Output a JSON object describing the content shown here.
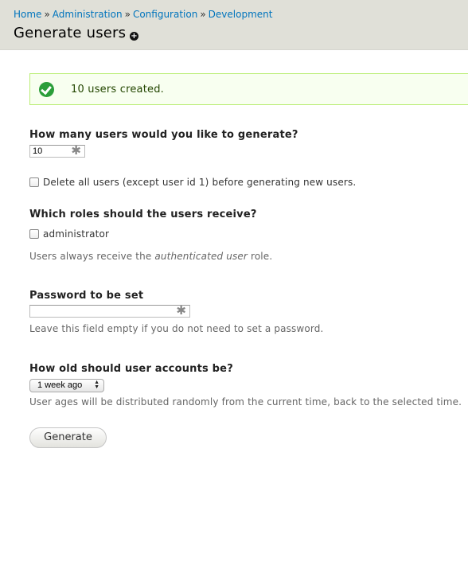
{
  "breadcrumb": {
    "items": [
      "Home",
      "Administration",
      "Configuration",
      "Development"
    ],
    "separator": "»"
  },
  "page": {
    "title": "Generate users",
    "shortcut_icon": "plus-circle-icon"
  },
  "message": {
    "text": "10 users created.",
    "icon": "check-circle-icon",
    "color": "#2b9e3a"
  },
  "form": {
    "num_users": {
      "label": "How many users would you like to generate?",
      "value": "10",
      "required_marker": "✱"
    },
    "delete_existing": {
      "label": "Delete all users (except user id 1) before generating new users.",
      "checked": false
    },
    "roles": {
      "label": "Which roles should the users receive?",
      "options": [
        {
          "label": "administrator",
          "checked": false
        }
      ],
      "description_prefix": "Users always receive the ",
      "description_em": "authenticated user",
      "description_suffix": " role."
    },
    "password": {
      "label": "Password to be set",
      "value": "",
      "required_marker": "✱",
      "description": "Leave this field empty if you do not need to set a password."
    },
    "age": {
      "label": "How old should user accounts be?",
      "selected": "1 week ago",
      "description": "User ages will be distributed randomly from the current time, back to the selected time."
    },
    "submit_label": "Generate"
  }
}
